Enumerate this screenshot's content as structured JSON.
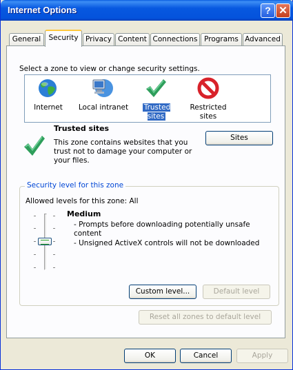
{
  "window": {
    "title": "Internet Options",
    "help_glyph": "?",
    "close_glyph": "✕"
  },
  "tabs": [
    "General",
    "Security",
    "Privacy",
    "Content",
    "Connections",
    "Programs",
    "Advanced"
  ],
  "active_tab": "Security",
  "security": {
    "instruction": "Select a zone to view or change security settings.",
    "zones": [
      {
        "label": "Internet",
        "icon": "globe-icon"
      },
      {
        "label": "Local intranet",
        "icon": "computer-network-icon"
      },
      {
        "label": "Trusted sites",
        "icon": "checkmark-icon",
        "selected": true
      },
      {
        "label": "Restricted\nsites",
        "icon": "no-entry-icon"
      }
    ],
    "zone_title": "Trusted sites",
    "zone_description": "This zone contains websites that you trust not to damage your computer or your files.",
    "sites_button": "Sites",
    "level_group_label": "Security level for this zone",
    "allowed_levels": "Allowed levels for this zone: All",
    "level_name": "Medium",
    "level_points": [
      "- Prompts before downloading potentially unsafe content",
      "- Unsigned ActiveX controls will not be downloaded"
    ],
    "level_slider_value": 2,
    "level_slider_max": 4,
    "custom_level_button": "Custom level...",
    "default_level_button": "Default level",
    "reset_all_button": "Reset all zones to default level"
  },
  "footer": {
    "ok": "OK",
    "cancel": "Cancel",
    "apply": "Apply"
  },
  "colors": {
    "title_blue": "#0453dc",
    "selection": "#316ac5",
    "legend_blue": "#0046d5",
    "dialog_bg": "#ece9d8"
  }
}
